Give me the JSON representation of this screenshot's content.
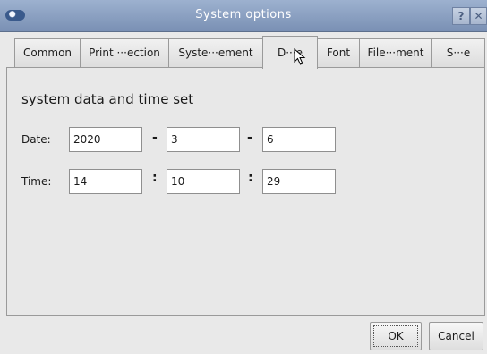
{
  "window": {
    "title": "System options",
    "help_label": "?",
    "close_label": "✕"
  },
  "tabs": [
    {
      "label": "Common",
      "active": false
    },
    {
      "label": "Print ···ection",
      "active": false
    },
    {
      "label": "Syste···ement",
      "active": false
    },
    {
      "label": "D···e",
      "active": true
    },
    {
      "label": "Font",
      "active": false
    },
    {
      "label": "File···ment",
      "active": false
    },
    {
      "label": "S···e",
      "active": false
    }
  ],
  "datetime": {
    "section_title": "system data and time set",
    "date_label": "Date:",
    "date_year": "2020",
    "date_month": "3",
    "date_day": "6",
    "date_separator": "-",
    "time_label": "Time:",
    "time_hour": "14",
    "time_minute": "10",
    "time_second": "29",
    "time_separator": ":"
  },
  "buttons": {
    "ok_label": "OK",
    "cancel_label": "Cancel"
  },
  "icons": {
    "app": "app-icon",
    "cursor": "mouse-pointer-icon"
  }
}
